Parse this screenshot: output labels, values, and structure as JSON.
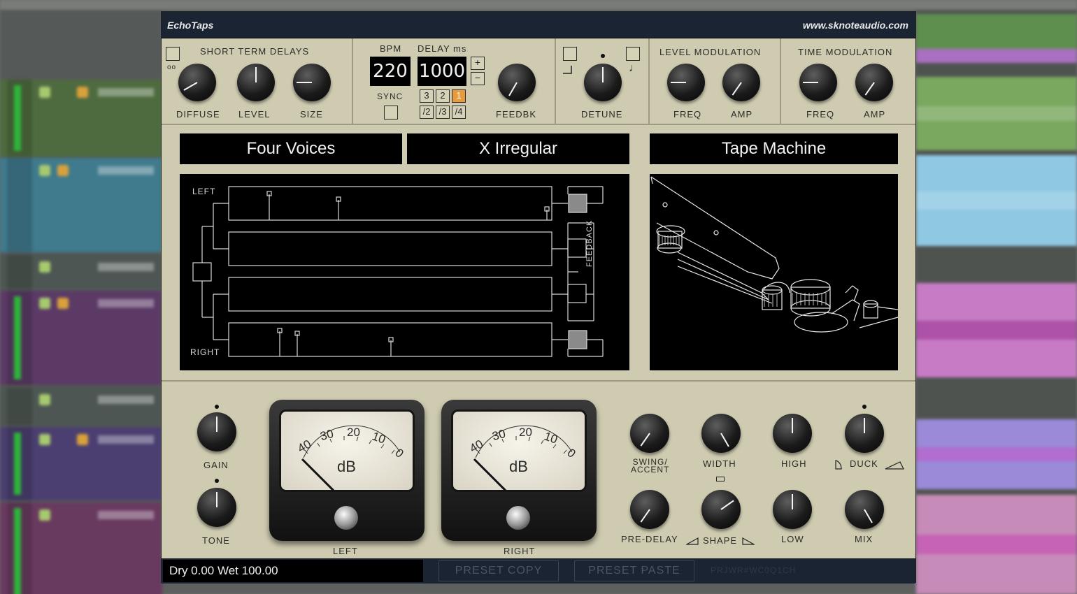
{
  "plugin": {
    "name": "EchoTaps",
    "url": "www.sknoteaudio.com"
  },
  "short_term": {
    "title": "SHORT TERM DELAYS",
    "stereo_glyph": "oo",
    "knobs": [
      {
        "label": "DIFFUSE",
        "angle": -120
      },
      {
        "label": "LEVEL",
        "angle": 0
      },
      {
        "label": "SIZE",
        "angle": -90
      }
    ]
  },
  "tempo": {
    "bpm_label": "BPM",
    "bpm": "220",
    "delay_label": "DELAY ms",
    "delay": "1000",
    "plus": "+",
    "minus": "−",
    "sync_label": "SYNC",
    "multipliers": [
      "3",
      "2",
      "1"
    ],
    "divisions": [
      "/2",
      "/3",
      "/4"
    ],
    "active_multiplier": "1",
    "feedback_label": "FEEDBK",
    "feedback_angle": -150
  },
  "detune": {
    "label": "DETUNE",
    "angle": 0,
    "note_glyph": "♩"
  },
  "level_mod": {
    "title": "LEVEL MODULATION",
    "knobs": [
      {
        "label": "FREQ",
        "angle": -90
      },
      {
        "label": "AMP",
        "angle": -145
      }
    ]
  },
  "time_mod": {
    "title": "TIME MODULATION",
    "knobs": [
      {
        "label": "FREQ",
        "angle": -90
      },
      {
        "label": "AMP",
        "angle": -145
      }
    ]
  },
  "presets": {
    "voices": "Four Voices",
    "pattern": "X Irregular",
    "style": "Tape Machine"
  },
  "tap_diagram": {
    "left_label": "LEFT",
    "right_label": "RIGHT",
    "feedback_label": "FEEDBACK"
  },
  "left_controls": {
    "gain_label": "GAIN",
    "gain_angle": 0,
    "tone_label": "TONE",
    "tone_angle": 0
  },
  "meters": [
    {
      "label": "LEFT",
      "unit": "dB",
      "ticks": [
        "40",
        "30",
        "20",
        "10",
        "0"
      ]
    },
    {
      "label": "RIGHT",
      "unit": "dB",
      "ticks": [
        "40",
        "30",
        "20",
        "10",
        "0"
      ]
    }
  ],
  "right_controls": {
    "swing_label": "SWING/\nACCENT",
    "swing_angle": -145,
    "width_label": "WIDTH",
    "width_angle": 150,
    "high_label": "HIGH",
    "high_angle": 0,
    "duck_label": "DUCK",
    "duck_angle": 0,
    "predelay_label": "PRE-DELAY",
    "predelay_angle": -145,
    "shape_label": "SHAPE",
    "shape_angle": 55,
    "low_label": "LOW",
    "low_angle": 0,
    "mix_label": "MIX",
    "mix_angle": 150
  },
  "status": {
    "text": "Dry 0.00 Wet 100.00",
    "preset_copy": "PRESET COPY",
    "preset_paste": "PRESET PASTE",
    "serial": "PRJWR#WC0Q1CH"
  }
}
